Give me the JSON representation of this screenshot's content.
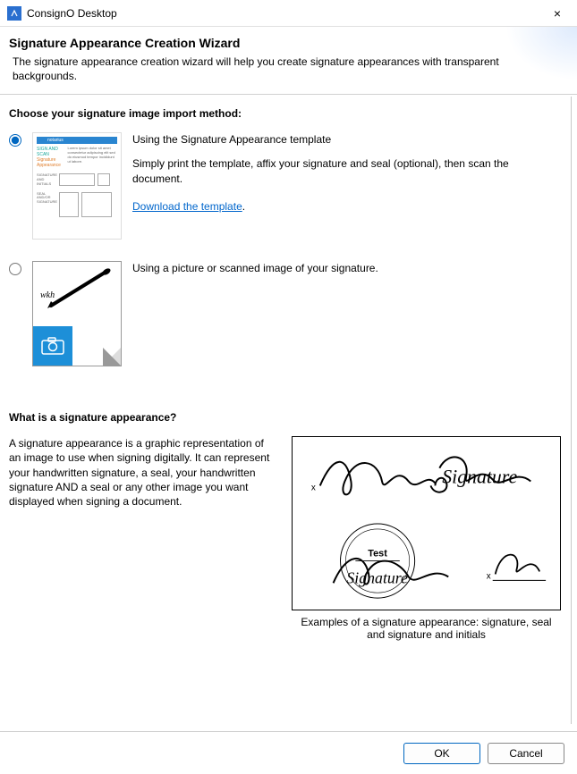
{
  "window": {
    "title": "ConsignO Desktop",
    "close_label": "×"
  },
  "header": {
    "title": "Signature Appearance Creation Wizard",
    "subtitle": "The signature appearance creation wizard will help you create signature appearances with transparent backgrounds."
  },
  "choose_label": "Choose your signature image import method:",
  "options": {
    "template": {
      "title": "Using the Signature Appearance template",
      "desc": "Simply print the template, affix your signature and seal (optional), then scan the document.",
      "link": "Download the template",
      "thumb_brand": "notarius",
      "selected": true
    },
    "picture": {
      "title": "Using a picture or scanned image of your signature.",
      "selected": false
    }
  },
  "what_is": {
    "heading": "What is a signature appearance?",
    "body": "A signature appearance is a graphic representation of an image to use when signing digitally. It can represent your handwritten signature, a seal, your handwritten signature AND a seal or any other image you want displayed when signing a document.",
    "caption": "Examples of a signature appearance: signature, seal and signature and initials",
    "example_seal_text": "Test"
  },
  "buttons": {
    "ok": "OK",
    "cancel": "Cancel"
  }
}
